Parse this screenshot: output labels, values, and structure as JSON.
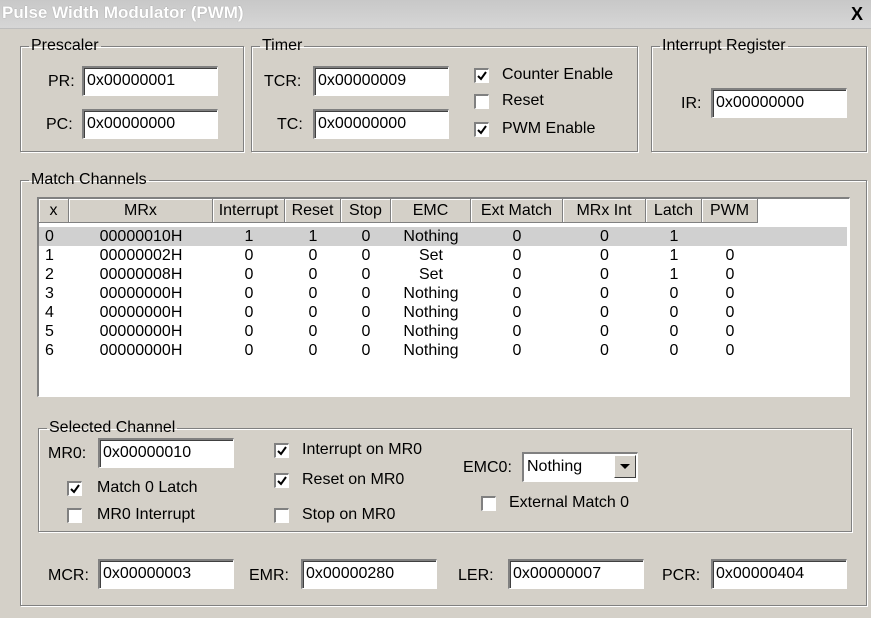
{
  "window": {
    "title": "Pulse Width Modulator (PWM)",
    "close_glyph": "X"
  },
  "prescaler": {
    "legend": "Prescaler",
    "pr_label": "PR:",
    "pr_value": "0x00000001",
    "pc_label": "PC:",
    "pc_value": "0x00000000"
  },
  "timer": {
    "legend": "Timer",
    "tcr_label": "TCR:",
    "tcr_value": "0x00000009",
    "tc_label": "TC:",
    "tc_value": "0x00000000",
    "counter_enable_label": "Counter Enable",
    "counter_enable_checked": true,
    "reset_label": "Reset",
    "reset_checked": false,
    "pwm_enable_label": "PWM Enable",
    "pwm_enable_checked": true
  },
  "interrupt": {
    "legend": "Interrupt Register",
    "ir_label": "IR:",
    "ir_value": "0x00000000"
  },
  "match_channels": {
    "legend": "Match Channels",
    "columns": [
      "x",
      "MRx",
      "Interrupt",
      "Reset",
      "Stop",
      "EMC",
      "Ext Match",
      "MRx Int",
      "Latch",
      "PWM"
    ],
    "rows": [
      [
        "0",
        "00000010H",
        "1",
        "1",
        "0",
        "Nothing",
        "0",
        "0",
        "1",
        ""
      ],
      [
        "1",
        "00000002H",
        "0",
        "0",
        "0",
        "Set",
        "0",
        "0",
        "1",
        "0"
      ],
      [
        "2",
        "00000008H",
        "0",
        "0",
        "0",
        "Set",
        "0",
        "0",
        "1",
        "0"
      ],
      [
        "3",
        "00000000H",
        "0",
        "0",
        "0",
        "Nothing",
        "0",
        "0",
        "0",
        "0"
      ],
      [
        "4",
        "00000000H",
        "0",
        "0",
        "0",
        "Nothing",
        "0",
        "0",
        "0",
        "0"
      ],
      [
        "5",
        "00000000H",
        "0",
        "0",
        "0",
        "Nothing",
        "0",
        "0",
        "0",
        "0"
      ],
      [
        "6",
        "00000000H",
        "0",
        "0",
        "0",
        "Nothing",
        "0",
        "0",
        "0",
        "0"
      ]
    ]
  },
  "selected_channel": {
    "legend": "Selected Channel",
    "mr0_label": "MR0:",
    "mr0_value": "0x00000010",
    "match0_latch_label": "Match 0 Latch",
    "match0_latch_checked": true,
    "mr0_interrupt_label": "MR0 Interrupt",
    "mr0_interrupt_checked": false,
    "interrupt_on_mr0_label": "Interrupt on MR0",
    "interrupt_on_mr0_checked": true,
    "reset_on_mr0_label": "Reset on MR0",
    "reset_on_mr0_checked": true,
    "stop_on_mr0_label": "Stop on MR0",
    "stop_on_mr0_checked": false,
    "emc0_label": "EMC0:",
    "emc0_value": "Nothing",
    "external_match0_label": "External Match 0",
    "external_match0_checked": false
  },
  "registers": {
    "mcr_label": "MCR:",
    "mcr_value": "0x00000003",
    "emr_label": "EMR:",
    "emr_value": "0x00000280",
    "ler_label": "LER:",
    "ler_value": "0x00000007",
    "pcr_label": "PCR:",
    "pcr_value": "0x00000404"
  }
}
